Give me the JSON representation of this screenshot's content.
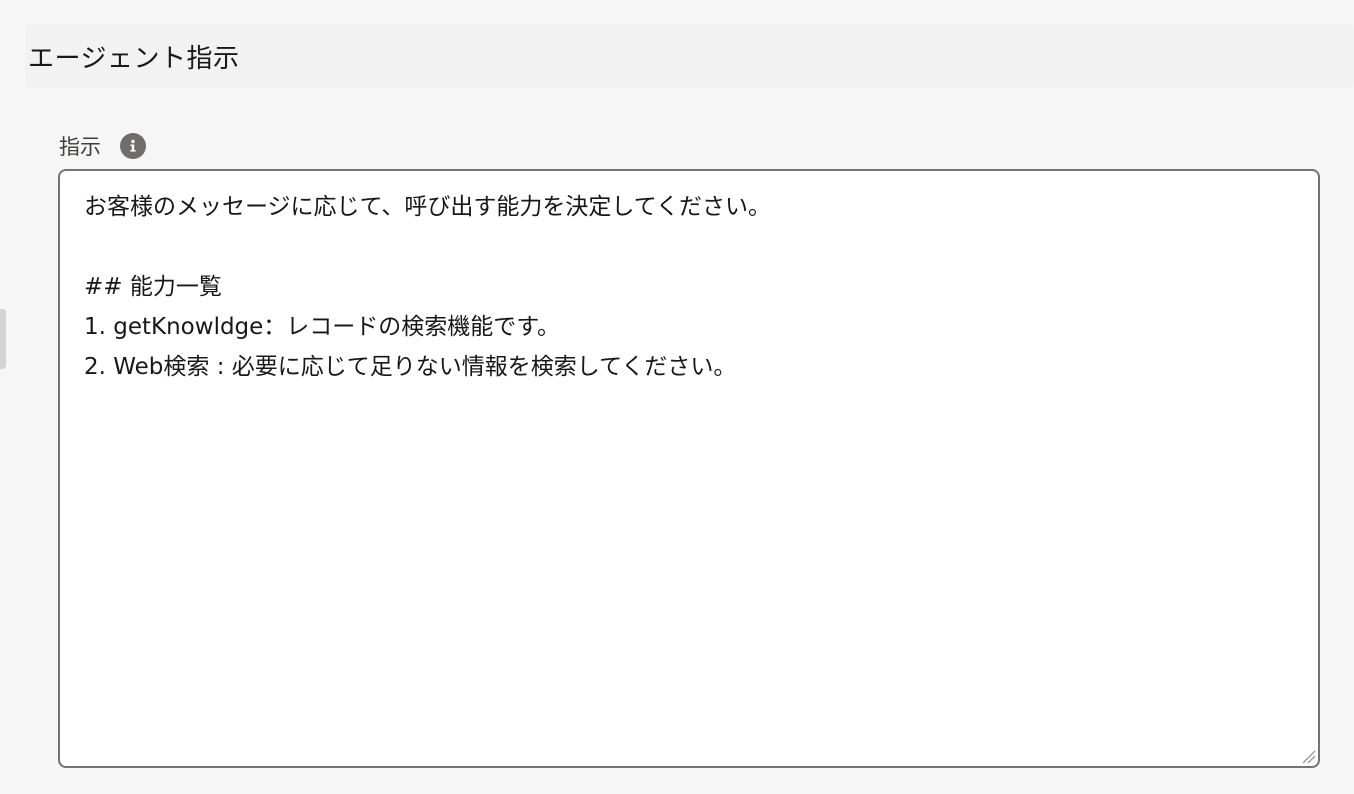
{
  "section": {
    "title": "エージェント指示"
  },
  "field": {
    "label": "指示",
    "info_icon": "info-icon"
  },
  "instructions": {
    "value": "お客様のメッセージに応じて、呼び出す能力を決定してください。\n\n## 能力一覧\n1. getKnowldge：レコードの検索機能です。\n2. Web検索 : 必要に応じて足りない情報を検索してください。"
  },
  "colors": {
    "page_bg": "#f6f6f6",
    "header_bg": "#f2f2f2",
    "textarea_border": "#747474",
    "icon_bg": "#706e6b"
  }
}
